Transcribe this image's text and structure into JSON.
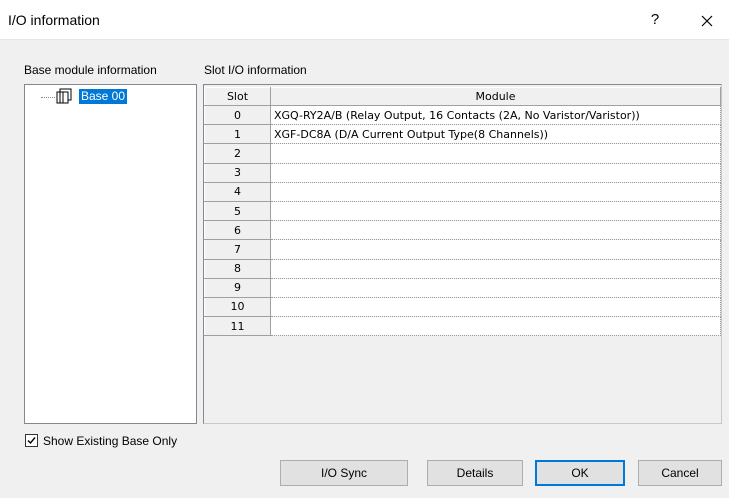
{
  "window": {
    "title": "I/O information",
    "help_glyph": "?",
    "close_glyph": "✕"
  },
  "labels": {
    "base_info": "Base module information",
    "slot_info": "Slot I/O information"
  },
  "tree": {
    "items": [
      {
        "label": "Base 00",
        "icon": "base-module-icon",
        "selected": true
      }
    ]
  },
  "table": {
    "headers": {
      "slot": "Slot",
      "module": "Module"
    },
    "rows": [
      {
        "slot": "0",
        "module": "XGQ-RY2A/B (Relay Output, 16 Contacts (2A, No Varistor/Varistor))"
      },
      {
        "slot": "1",
        "module": "XGF-DC8A (D/A Current Output Type(8 Channels))"
      },
      {
        "slot": "2",
        "module": ""
      },
      {
        "slot": "3",
        "module": ""
      },
      {
        "slot": "4",
        "module": ""
      },
      {
        "slot": "5",
        "module": ""
      },
      {
        "slot": "6",
        "module": ""
      },
      {
        "slot": "7",
        "module": ""
      },
      {
        "slot": "8",
        "module": ""
      },
      {
        "slot": "9",
        "module": ""
      },
      {
        "slot": "10",
        "module": ""
      },
      {
        "slot": "11",
        "module": ""
      }
    ]
  },
  "checkbox": {
    "label": "Show Existing Base Only",
    "checked": true
  },
  "buttons": {
    "io_sync": "I/O Sync",
    "details": "Details",
    "ok": "OK",
    "cancel": "Cancel"
  },
  "colors": {
    "selection": "#0078d7",
    "default_button_border": "#0078d7"
  }
}
